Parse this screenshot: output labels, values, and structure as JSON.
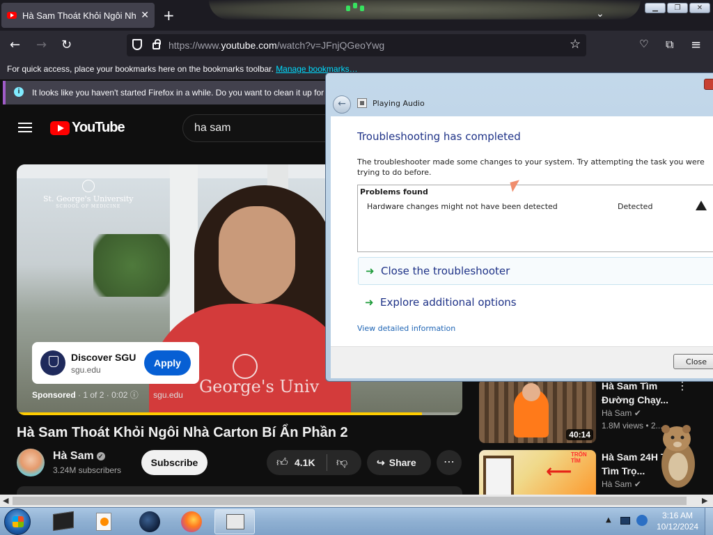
{
  "browser": {
    "tab_title": "Hà Sam Thoát Khỏi Ngôi Nhà C",
    "tab_close": "✕",
    "new_tab": "+",
    "url_prefix": "https://www.",
    "url_domain": "youtube.com",
    "url_path": "/watch?v=JFnjQGeoYwg",
    "bookmarks_text": "For quick access, place your bookmarks here on the bookmarks toolbar. ",
    "bookmarks_link": "Manage bookmarks…",
    "notification_text": "It looks like you haven't started Firefox in a while. Do you want to clean it up for a"
  },
  "youtube": {
    "logo_text": "YouTube",
    "search_value": "ha sam",
    "ad": {
      "title": "Discover SGU",
      "url": "sgu.edu",
      "apply_label": "Apply",
      "sponsored": "Sponsored",
      "position": "1 of 2",
      "time": "0:02",
      "domain": "sgu.edu"
    },
    "video_overlay": {
      "logo_line1": "St. George's University",
      "logo_line2": "SCHOOL OF MEDICINE",
      "shirt_text": "George's Univ"
    },
    "video_title": "Hà Sam Thoát Khỏi Ngôi Nhà Carton Bí Ẩn Phần 2",
    "channel_name": "Hà Sam",
    "subscribers": "3.24M subscribers",
    "subscribe_label": "Subscribe",
    "likes": "4.1K",
    "share_label": "Share",
    "ad_progress_percent": 91,
    "recommendations": [
      {
        "title": "Hà Sam Tìm Đường Chạy...",
        "channel": "Hà Sam",
        "meta": "1.8M views • 2...",
        "duration": "40:14"
      },
      {
        "title": "Hà Sam 24H Trốn Tìm Trọ...",
        "channel": "Hà Sam",
        "thumb_tag": "TRỐN TÌM"
      }
    ]
  },
  "dialog": {
    "caption": "Playing Audio",
    "heading": "Troubleshooting has completed",
    "description": "The troubleshooter made some changes to your system. Try attempting the task you were trying to do before.",
    "problems_title": "Problems found",
    "problem_text": "Hardware changes might not have been detected",
    "problem_status": "Detected",
    "link_close": "Close the troubleshooter",
    "link_explore": "Explore additional options",
    "details_link": "View detailed information",
    "close_button": "Close"
  },
  "taskbar": {
    "time": "3:16 AM",
    "date": "10/12/2024"
  }
}
